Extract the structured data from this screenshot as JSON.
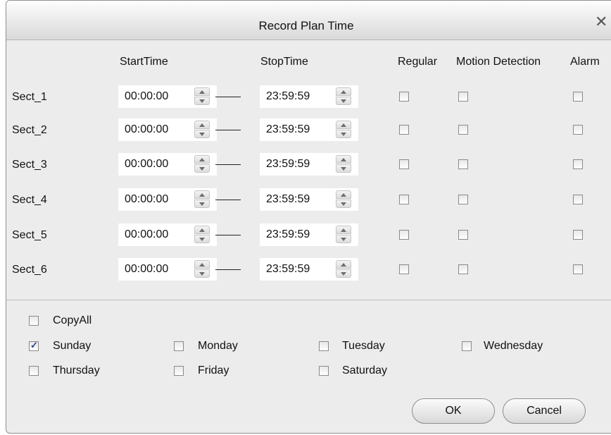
{
  "window": {
    "title": "Record Plan Time",
    "close_icon": "close-icon"
  },
  "headers": {
    "start": "StartTime",
    "stop": "StopTime",
    "regular": "Regular",
    "motion": "Motion Detection",
    "alarm": "Alarm"
  },
  "sections": [
    {
      "label": "Sect_1",
      "start": "00:00:00",
      "stop": "23:59:59",
      "regular": false,
      "motion": false,
      "alarm": false
    },
    {
      "label": "Sect_2",
      "start": "00:00:00",
      "stop": "23:59:59",
      "regular": false,
      "motion": false,
      "alarm": false
    },
    {
      "label": "Sect_3",
      "start": "00:00:00",
      "stop": "23:59:59",
      "regular": false,
      "motion": false,
      "alarm": false
    },
    {
      "label": "Sect_4",
      "start": "00:00:00",
      "stop": "23:59:59",
      "regular": false,
      "motion": false,
      "alarm": false
    },
    {
      "label": "Sect_5",
      "start": "00:00:00",
      "stop": "23:59:59",
      "regular": false,
      "motion": false,
      "alarm": false
    },
    {
      "label": "Sect_6",
      "start": "00:00:00",
      "stop": "23:59:59",
      "regular": false,
      "motion": false,
      "alarm": false
    }
  ],
  "copy_all": {
    "label": "CopyAll",
    "checked": false
  },
  "days": [
    {
      "label": "Sunday",
      "checked": true
    },
    {
      "label": "Monday",
      "checked": false
    },
    {
      "label": "Tuesday",
      "checked": false
    },
    {
      "label": "Wednesday",
      "checked": false
    },
    {
      "label": "Thursday",
      "checked": false
    },
    {
      "label": "Friday",
      "checked": false
    },
    {
      "label": "Saturday",
      "checked": false
    }
  ],
  "buttons": {
    "ok": "OK",
    "cancel": "Cancel"
  }
}
